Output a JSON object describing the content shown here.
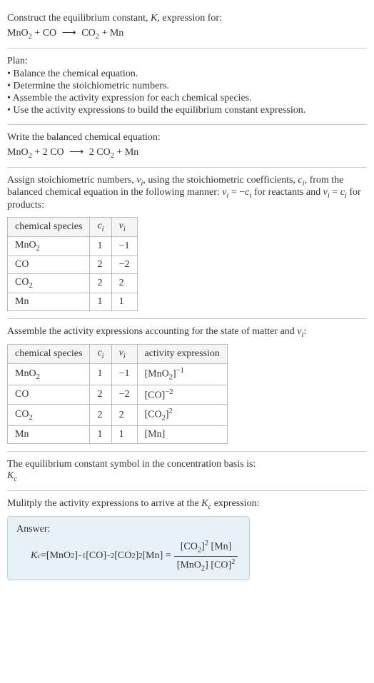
{
  "intro": {
    "prompt": "Construct the equilibrium constant, ",
    "k": "K",
    "prompt2": ", expression for:",
    "eq_l1": "MnO",
    "eq_l2": " + CO",
    "arrow": "⟶",
    "eq_r1": "CO",
    "eq_r2": " + Mn",
    "sub2": "2"
  },
  "plan": {
    "title": "Plan:",
    "items": [
      "• Balance the chemical equation.",
      "• Determine the stoichiometric numbers.",
      "• Assemble the activity expression for each chemical species.",
      "• Use the activity expressions to build the equilibrium constant expression."
    ]
  },
  "balanced": {
    "title": "Write the balanced chemical equation:",
    "l1": "MnO",
    "l2": " + 2 CO",
    "arrow": "⟶",
    "r1": "2 CO",
    "r2": " + Mn",
    "sub2": "2"
  },
  "stoich": {
    "text1": "Assign stoichiometric numbers, ",
    "nu": "ν",
    "sub_i": "i",
    "text2": ", using the stoichiometric coefficients, ",
    "c": "c",
    "text3": ", from the balanced chemical equation in the following manner: ",
    "rel1a": "ν",
    "rel1b": " = −",
    "rel1c": "c",
    "text4": " for reactants and ",
    "rel2a": "ν",
    "rel2b": " = ",
    "rel2c": "c",
    "text5": " for products:",
    "headers": {
      "species": "chemical species",
      "ci": "c",
      "nui": "ν"
    },
    "rows": [
      {
        "species_a": "MnO",
        "species_sub": "2",
        "species_b": "",
        "ci": "1",
        "nui": "−1"
      },
      {
        "species_a": "CO",
        "species_sub": "",
        "species_b": "",
        "ci": "2",
        "nui": "−2"
      },
      {
        "species_a": "CO",
        "species_sub": "2",
        "species_b": "",
        "ci": "2",
        "nui": "2"
      },
      {
        "species_a": "Mn",
        "species_sub": "",
        "species_b": "",
        "ci": "1",
        "nui": "1"
      }
    ]
  },
  "activity": {
    "text1": "Assemble the activity expressions accounting for the state of matter and ",
    "nu": "ν",
    "sub_i": "i",
    "text2": ":",
    "headers": {
      "species": "chemical species",
      "ci": "c",
      "nui": "ν",
      "act": "activity expression"
    },
    "rows": [
      {
        "species_a": "MnO",
        "species_sub": "2",
        "ci": "1",
        "nui": "−1",
        "act_a": "[MnO",
        "act_sub": "2",
        "act_b": "]",
        "act_sup": "−1"
      },
      {
        "species_a": "CO",
        "species_sub": "",
        "ci": "2",
        "nui": "−2",
        "act_a": "[CO",
        "act_sub": "",
        "act_b": "]",
        "act_sup": "−2"
      },
      {
        "species_a": "CO",
        "species_sub": "2",
        "ci": "2",
        "nui": "2",
        "act_a": "[CO",
        "act_sub": "2",
        "act_b": "]",
        "act_sup": "2"
      },
      {
        "species_a": "Mn",
        "species_sub": "",
        "ci": "1",
        "nui": "1",
        "act_a": "[Mn",
        "act_sub": "",
        "act_b": "]",
        "act_sup": ""
      }
    ]
  },
  "symbol": {
    "text": "The equilibrium constant symbol in the concentration basis is:",
    "k": "K",
    "sub_c": "c"
  },
  "final": {
    "text1": "Mulitply the activity expressions to arrive at the ",
    "k": "K",
    "sub_c": "c",
    "text2": " expression:",
    "answer_label": "Answer:",
    "lhs_k": "K",
    "eq": " = ",
    "f1a": "[MnO",
    "f1sub": "2",
    "f1b": "]",
    "f1sup": "−1",
    "f2a": " [CO",
    "f2b": "]",
    "f2sup": "−2",
    "f3a": " [CO",
    "f3sub": "2",
    "f3b": "]",
    "f3sup": "2",
    "f4": " [Mn] = ",
    "num_a": "[CO",
    "num_sub": "2",
    "num_b": "]",
    "num_sup": "2",
    "num_c": " [Mn]",
    "den_a": "[MnO",
    "den_sub": "2",
    "den_b": "] [CO]",
    "den_sup": "2"
  }
}
